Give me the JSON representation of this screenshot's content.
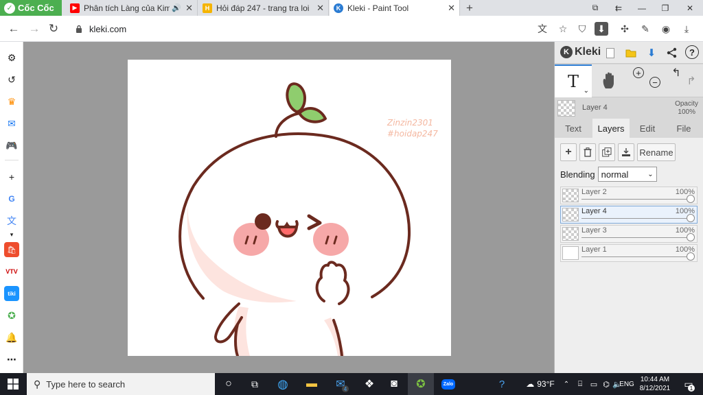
{
  "browser": {
    "brand": "Cốc Cốc",
    "tabs": [
      {
        "title": "Phân tích Làng của Kim L",
        "active": false
      },
      {
        "title": "Hỏi đáp 247 - trang tra loi",
        "active": false
      },
      {
        "title": "Kleki - Paint Tool",
        "active": true
      }
    ],
    "url": "kleki.com"
  },
  "canvas": {
    "watermark": [
      "Zinzin2301",
      "#hoidap247"
    ]
  },
  "kleki": {
    "logo": "Kleki",
    "current_layer": "Layer 4",
    "opacity_label": "Opacity",
    "opacity_value": "100%",
    "tabs": [
      "Text",
      "Layers",
      "Edit",
      "File"
    ],
    "active_tab": "Layers",
    "rename_label": "Rename",
    "blending_label": "Blending",
    "blending_value": "normal",
    "layers": [
      {
        "name": "Layer 2",
        "opacity": "100%"
      },
      {
        "name": "Layer 4",
        "opacity": "100%"
      },
      {
        "name": "Layer 3",
        "opacity": "100%"
      },
      {
        "name": "Layer 1",
        "opacity": "100%"
      }
    ]
  },
  "taskbar": {
    "search_placeholder": "Type here to search",
    "mail_badge": "4",
    "weather": "93°F",
    "language": "ENG",
    "time": "10:44 AM",
    "date": "8/12/2021",
    "notification_badge": "1"
  },
  "colors": {
    "accent": "#2b7cd3",
    "outline": "#6b2a1f",
    "leaf": "#8fcd6e",
    "blush": "#f6a8a8",
    "brand_green": "#4caf50"
  }
}
